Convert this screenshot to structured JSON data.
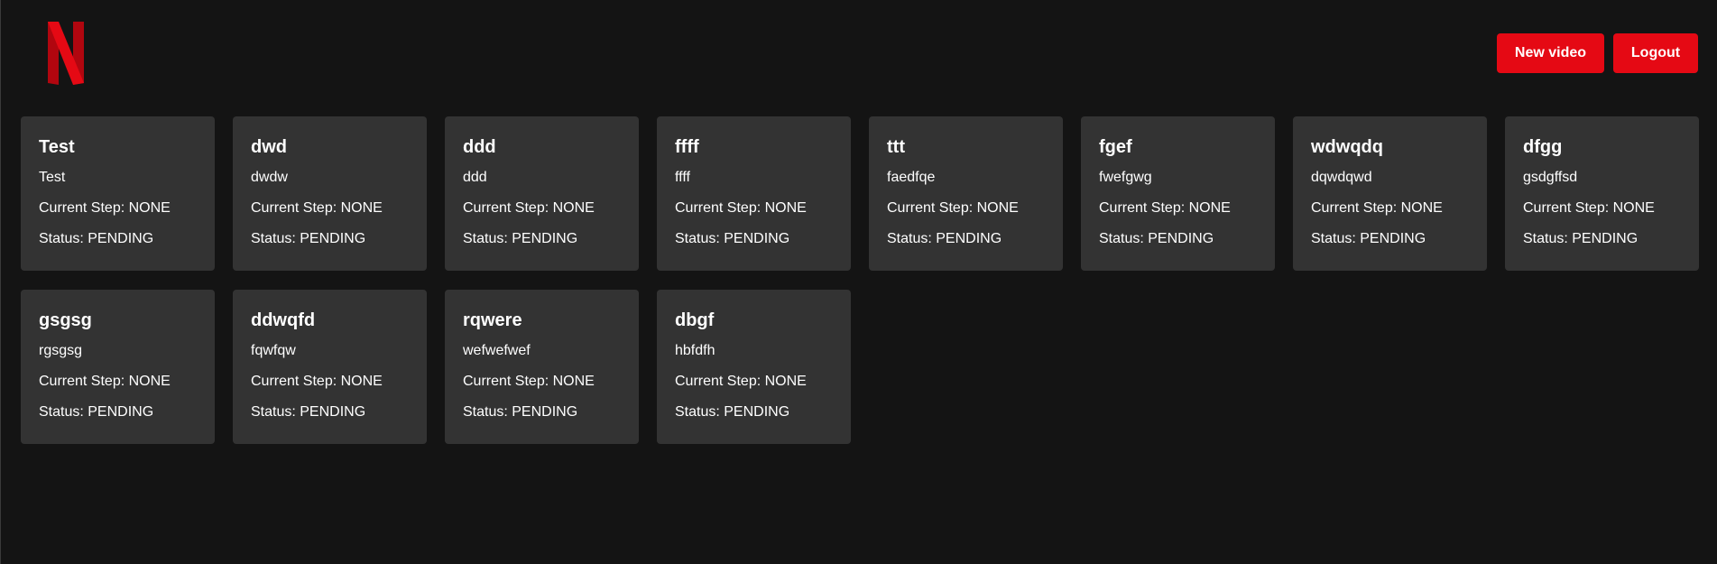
{
  "header": {
    "new_video_label": "New video",
    "logout_label": "Logout"
  },
  "colors": {
    "background": "#141414",
    "card": "#333333",
    "accent": "#e50914"
  },
  "videos": [
    {
      "title": "Test",
      "description": "Test",
      "current_step": "Current Step: NONE",
      "status": "Status: PENDING"
    },
    {
      "title": "dwd",
      "description": "dwdw",
      "current_step": "Current Step: NONE",
      "status": "Status: PENDING"
    },
    {
      "title": "ddd",
      "description": "ddd",
      "current_step": "Current Step: NONE",
      "status": "Status: PENDING"
    },
    {
      "title": "ffff",
      "description": "ffff",
      "current_step": "Current Step: NONE",
      "status": "Status: PENDING"
    },
    {
      "title": "ttt",
      "description": "faedfqe",
      "current_step": "Current Step: NONE",
      "status": "Status: PENDING"
    },
    {
      "title": "fgef",
      "description": "fwefgwg",
      "current_step": "Current Step: NONE",
      "status": "Status: PENDING"
    },
    {
      "title": "wdwqdq",
      "description": "dqwdqwd",
      "current_step": "Current Step: NONE",
      "status": "Status: PENDING"
    },
    {
      "title": "dfgg",
      "description": "gsdgffsd",
      "current_step": "Current Step: NONE",
      "status": "Status: PENDING"
    },
    {
      "title": "gsgsg",
      "description": "rgsgsg",
      "current_step": "Current Step: NONE",
      "status": "Status: PENDING"
    },
    {
      "title": "ddwqfd",
      "description": "fqwfqw",
      "current_step": "Current Step: NONE",
      "status": "Status: PENDING"
    },
    {
      "title": "rqwere",
      "description": "wefwefwef",
      "current_step": "Current Step: NONE",
      "status": "Status: PENDING"
    },
    {
      "title": "dbgf",
      "description": "hbfdfh",
      "current_step": "Current Step: NONE",
      "status": "Status: PENDING"
    }
  ]
}
